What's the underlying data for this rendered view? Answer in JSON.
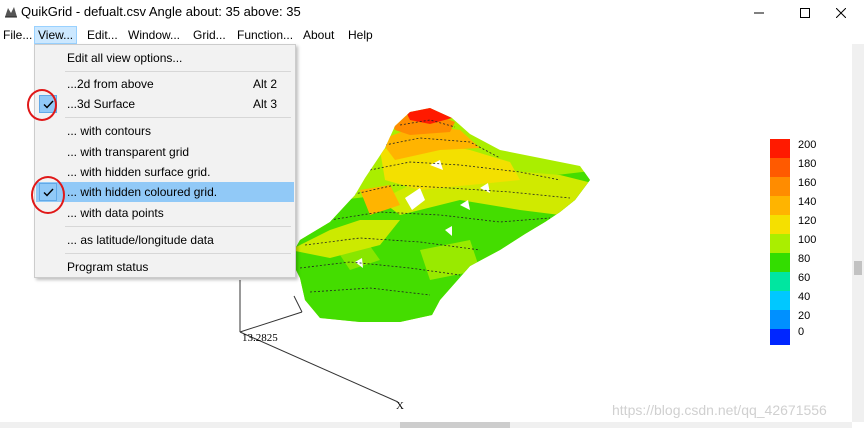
{
  "window": {
    "title": "QuikGrid - defualt.csv Angle about: 35 above: 35",
    "app_icon": "quikgrid-icon",
    "controls": [
      "minimize-icon",
      "maximize-icon",
      "close-icon"
    ]
  },
  "menubar": {
    "items": [
      "File...",
      "View...",
      "Edit...",
      "Window...",
      "Grid...",
      "Function...",
      "About",
      "Help"
    ],
    "open_item": "View..."
  },
  "view_menu": {
    "items": [
      {
        "label": "Edit all view options...",
        "accel": "",
        "checked": false,
        "highlighted": false
      },
      {
        "label": "...2d from above",
        "accel": "Alt 2",
        "checked": false,
        "highlighted": false
      },
      {
        "label": "...3d Surface",
        "accel": "Alt 3",
        "checked": true,
        "highlighted": false
      },
      {
        "label": "... with contours",
        "accel": "",
        "checked": false,
        "highlighted": false
      },
      {
        "label": "... with transparent grid",
        "accel": "",
        "checked": false,
        "highlighted": false
      },
      {
        "label": "... with hidden surface grid.",
        "accel": "",
        "checked": false,
        "highlighted": false
      },
      {
        "label": "... with hidden coloured grid.",
        "accel": "",
        "checked": true,
        "highlighted": true
      },
      {
        "label": "... with data points",
        "accel": "",
        "checked": false,
        "highlighted": false
      },
      {
        "label": "... as latitude/longitude data",
        "accel": "",
        "checked": false,
        "highlighted": false
      },
      {
        "label": "Program status",
        "accel": "",
        "checked": false,
        "highlighted": false
      }
    ]
  },
  "plot": {
    "axis_value_label": "13.2825",
    "axis_x_label": "X"
  },
  "legend": {
    "labels": [
      "200",
      "180",
      "160",
      "140",
      "120",
      "100",
      "80",
      "60",
      "40",
      "20",
      "0"
    ],
    "colors": [
      "#ff1a00",
      "#ff5a00",
      "#ff8c00",
      "#ffb400",
      "#f5e000",
      "#aaee00",
      "#33dd00",
      "#00e6a0",
      "#00c8ff",
      "#0090ff",
      "#0026ff"
    ]
  },
  "annotations": {
    "circle_color": "#e01818"
  },
  "watermark": "https://blog.csdn.net/qq_42671556"
}
